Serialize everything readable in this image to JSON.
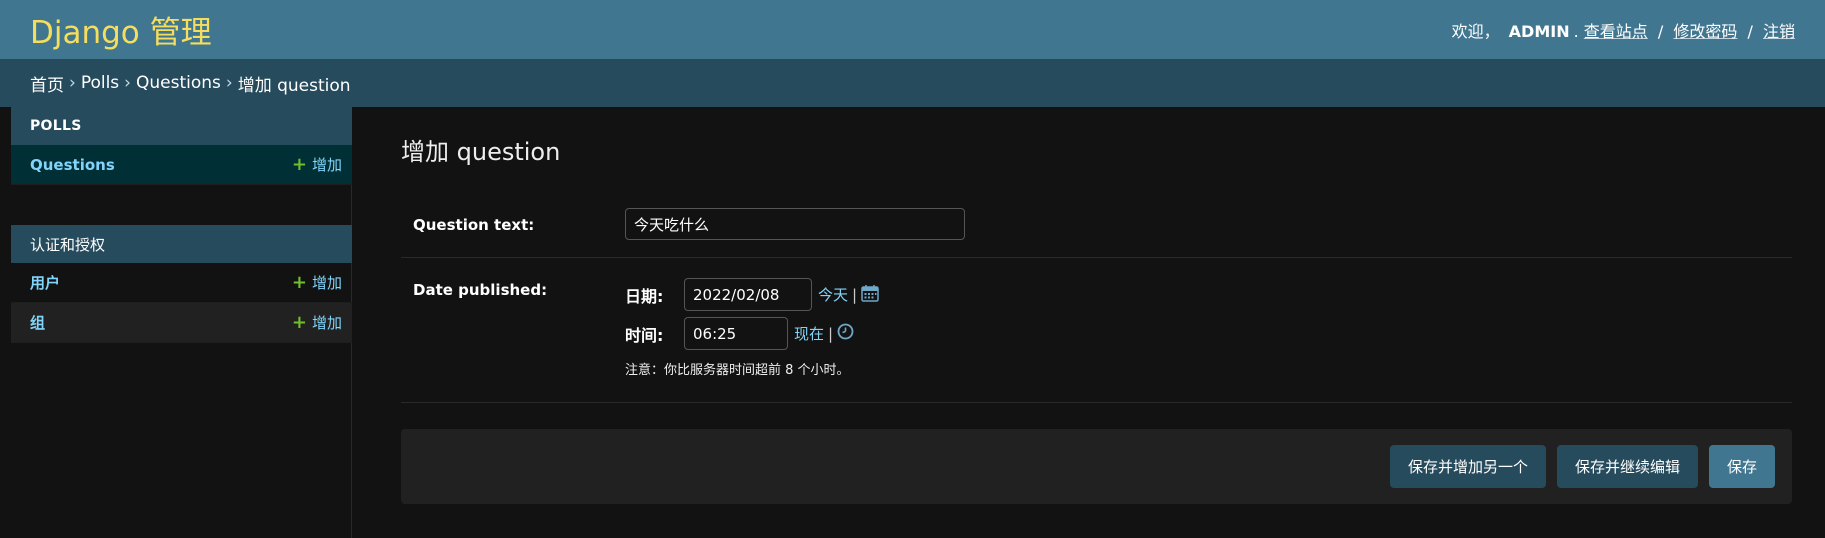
{
  "header": {
    "brand": "Django 管理",
    "welcome": "欢迎，",
    "username": "ADMIN",
    "dot": ".",
    "links": [
      "查看站点",
      "修改密码",
      "注销"
    ],
    "separator": "/"
  },
  "breadcrumbs": {
    "items": [
      "首页",
      "Polls",
      "Questions",
      "增加 question"
    ],
    "separator": "›"
  },
  "sidebar": {
    "modules": [
      {
        "caption": "POLLS",
        "models": [
          {
            "name": "Questions",
            "add": "增加",
            "current": true
          }
        ]
      },
      {
        "caption": "认证和授权",
        "models": [
          {
            "name": "用户",
            "add": "增加"
          },
          {
            "name": "组",
            "add": "增加"
          }
        ]
      }
    ]
  },
  "main": {
    "title": "增加 question",
    "question_text": {
      "label": "Question text:",
      "value": "今天吃什么"
    },
    "date_published": {
      "label": "Date published:",
      "date_label": "日期:",
      "date_value": "2022/02/08",
      "today_link": "今天",
      "time_label": "时间:",
      "time_value": "06:25",
      "now_link": "现在",
      "bar": "|",
      "note": "注意：你比服务器时间超前 8 个小时。"
    },
    "buttons": {
      "save_add_another": "保存并增加另一个",
      "save_continue": "保存并继续编辑",
      "save": "保存"
    }
  },
  "colors": {
    "header_bg": "#417690",
    "brand": "#f5dd5d",
    "breadcrumbs_bg": "#264b5d",
    "link": "#81d4fa",
    "add_plus": "#70bf2b",
    "background": "#121212"
  },
  "icons": [
    "plus-icon",
    "calendar-icon",
    "clock-icon"
  ]
}
